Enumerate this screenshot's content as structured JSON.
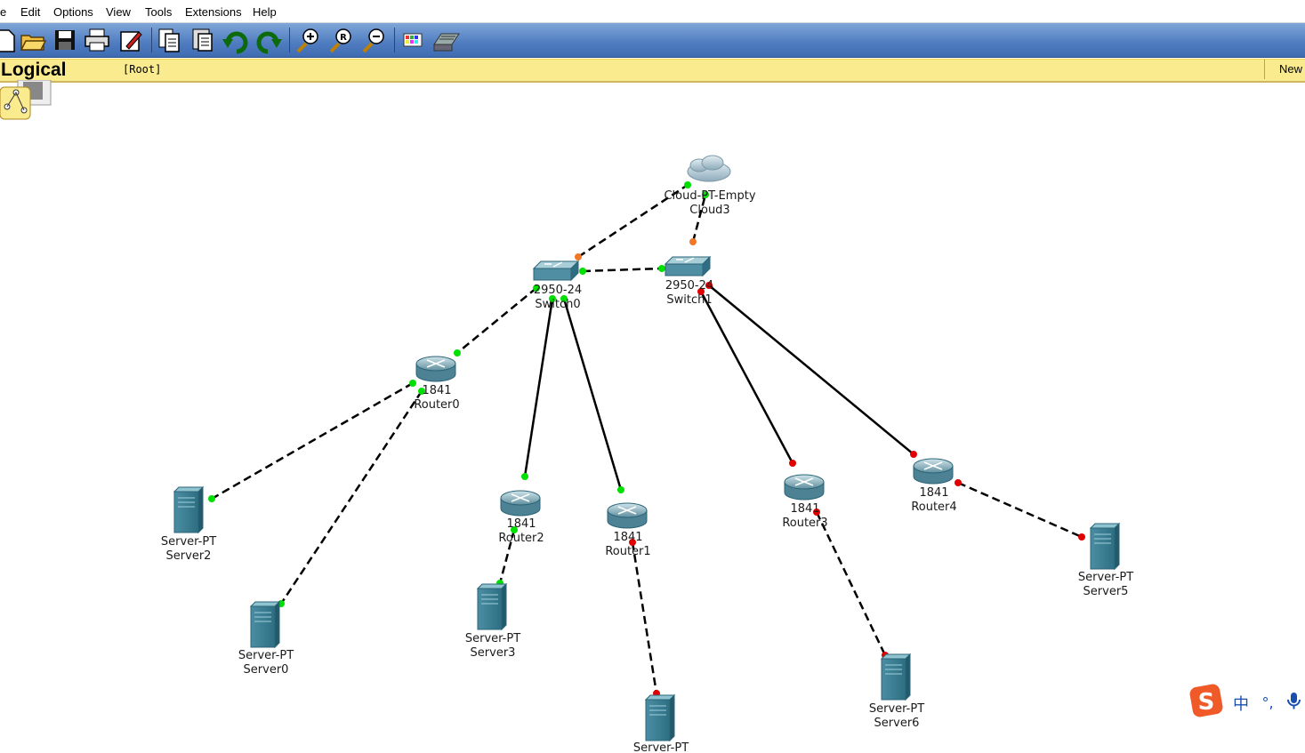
{
  "menu": [
    {
      "label": "e"
    },
    {
      "label": "Edit"
    },
    {
      "label": "Options"
    },
    {
      "label": "View"
    },
    {
      "label": "Tools"
    },
    {
      "label": "Extensions"
    },
    {
      "label": "Help"
    }
  ],
  "toolbar": {
    "buttons": [
      "new-icon",
      "open-icon",
      "save-icon",
      "print-icon",
      "activity-wizard-icon",
      "copy-icon",
      "paste-icon",
      "undo-icon",
      "redo-icon",
      "zoom-in-icon",
      "zoom-reset-icon",
      "zoom-out-icon",
      "palette-icon",
      "custom-device-icon"
    ]
  },
  "workspace_bar": {
    "title": "Logical",
    "path": "[Root]",
    "new_cluster_label": "New"
  },
  "devices": [
    {
      "id": "cloud3",
      "model": "Cloud-PT-Empty",
      "name": "Cloud3",
      "type": "cloud"
    },
    {
      "id": "switch0",
      "model": "2950-24",
      "name": "Switch0",
      "type": "switch"
    },
    {
      "id": "switch1",
      "model": "2950-24",
      "name": "Switch1",
      "type": "switch"
    },
    {
      "id": "router0",
      "model": "1841",
      "name": "Router0",
      "type": "router"
    },
    {
      "id": "router2",
      "model": "1841",
      "name": "Router2",
      "type": "router"
    },
    {
      "id": "router1",
      "model": "1841",
      "name": "Router1",
      "type": "router"
    },
    {
      "id": "router3",
      "model": "1841",
      "name": "Router3",
      "type": "router"
    },
    {
      "id": "router4",
      "model": "1841",
      "name": "Router4",
      "type": "router"
    },
    {
      "id": "server2",
      "model": "Server-PT",
      "name": "Server2",
      "type": "server"
    },
    {
      "id": "server0",
      "model": "Server-PT",
      "name": "Server0",
      "type": "server"
    },
    {
      "id": "server3",
      "model": "Server-PT",
      "name": "Server3",
      "type": "server"
    },
    {
      "id": "server1",
      "model": "Server-PT",
      "name": "",
      "type": "server"
    },
    {
      "id": "server6",
      "model": "Server-PT",
      "name": "Server6",
      "type": "server"
    },
    {
      "id": "server5",
      "model": "Server-PT",
      "name": "Server5",
      "type": "server"
    }
  ],
  "links": [
    {
      "from": "switch0",
      "to": "cloud3",
      "style": "dashed",
      "status": [
        "orange",
        "green"
      ]
    },
    {
      "from": "switch1",
      "to": "cloud3",
      "style": "dashed",
      "status": [
        "orange",
        "green"
      ]
    },
    {
      "from": "switch0",
      "to": "switch1",
      "style": "dashed",
      "status": [
        "green",
        "green"
      ]
    },
    {
      "from": "switch0",
      "to": "router0",
      "style": "dashed",
      "status": [
        "green",
        "green"
      ]
    },
    {
      "from": "switch0",
      "to": "router2",
      "style": "solid",
      "status": [
        "green",
        "green"
      ]
    },
    {
      "from": "switch0",
      "to": "router1",
      "style": "solid",
      "status": [
        "green",
        "green"
      ]
    },
    {
      "from": "switch1",
      "to": "router3",
      "style": "solid",
      "status": [
        "red",
        "red"
      ]
    },
    {
      "from": "switch1",
      "to": "router4",
      "style": "solid",
      "status": [
        "red",
        "red"
      ]
    },
    {
      "from": "router0",
      "to": "server2",
      "style": "dashed",
      "status": [
        "green",
        "green"
      ]
    },
    {
      "from": "router0",
      "to": "server0",
      "style": "dashed",
      "status": [
        "green",
        "green"
      ]
    },
    {
      "from": "router2",
      "to": "server3",
      "style": "dashed",
      "status": [
        "green",
        "green"
      ]
    },
    {
      "from": "router1",
      "to": "server1",
      "style": "dashed",
      "status": [
        "red",
        "red"
      ]
    },
    {
      "from": "router3",
      "to": "server6",
      "style": "dashed",
      "status": [
        "red",
        "red"
      ]
    },
    {
      "from": "router4",
      "to": "server5",
      "style": "dashed",
      "status": [
        "red",
        "red"
      ]
    }
  ],
  "colors": {
    "link_up": "#00e000",
    "link_down": "#e00000",
    "link_pending": "#f07828",
    "toolbar_blue": "#4f7cc0",
    "workspace_bar": "#fbeb8f"
  },
  "ime": {
    "label_cn": "中",
    "punct": "°,"
  }
}
